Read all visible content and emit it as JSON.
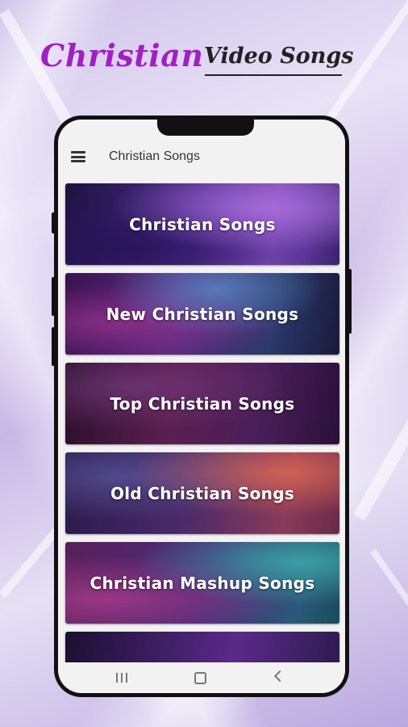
{
  "promo": {
    "title_main": "Christian",
    "title_sub": "Video Songs"
  },
  "appbar": {
    "title": "Christian Songs",
    "menu_icon": "hamburger-menu-icon"
  },
  "categories": [
    {
      "label": "Christian Songs"
    },
    {
      "label": "New Christian Songs"
    },
    {
      "label": "Top Christian Songs"
    },
    {
      "label": "Old Christian Songs"
    },
    {
      "label": "Christian Mashup Songs"
    },
    {
      "label": ""
    }
  ],
  "navbar": {
    "recent_icon": "recent-apps-icon",
    "home_icon": "home-icon",
    "back_icon": "back-icon"
  },
  "colors": {
    "title_accent": "#a21fc4",
    "title_dark": "#222222",
    "phone_frame": "#111111",
    "screen_bg": "#f2f2f2"
  }
}
